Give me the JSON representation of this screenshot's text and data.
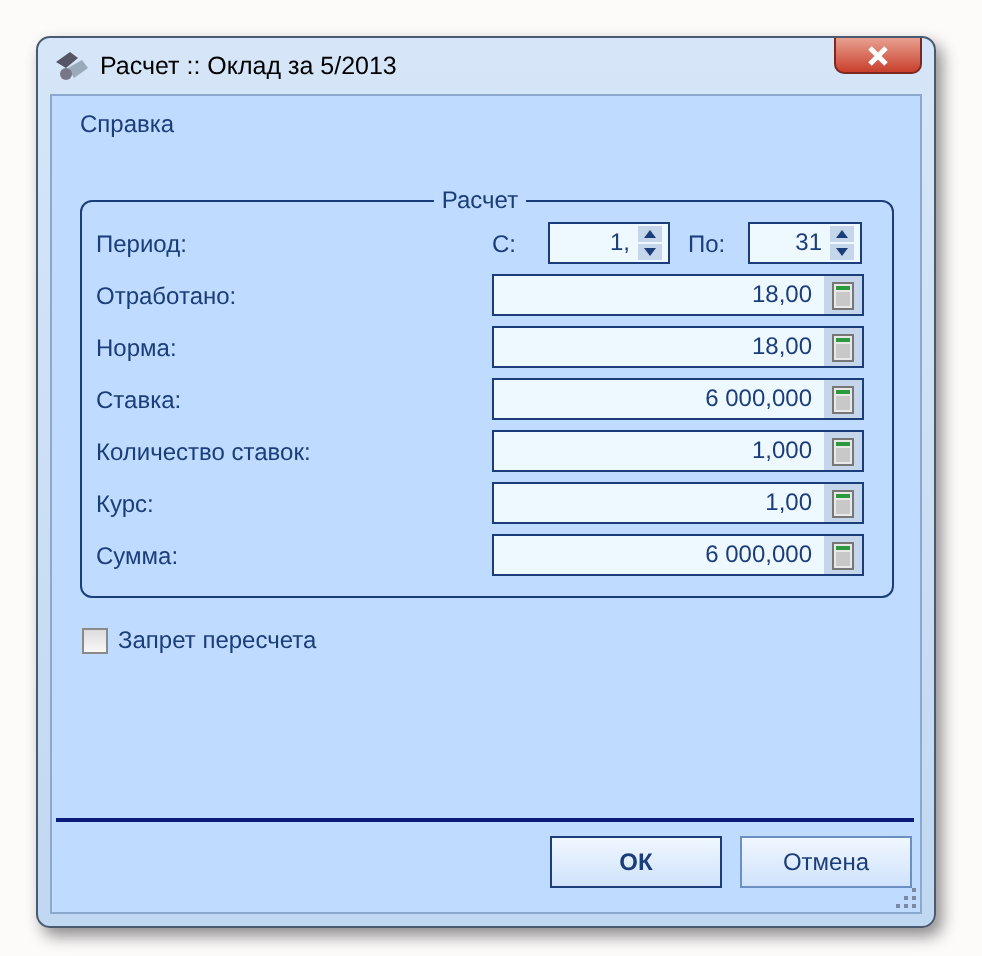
{
  "window": {
    "title": "Расчет :: Оклад за 5/2013"
  },
  "help_link": "Справка",
  "group": {
    "title": "Расчет",
    "period": {
      "label": "Период:",
      "from_label": "С:",
      "from_value": "1,",
      "to_label": "По:",
      "to_value": "31"
    },
    "fields": [
      {
        "label": "Отработано:",
        "value": "18,00"
      },
      {
        "label": "Норма:",
        "value": "18,00"
      },
      {
        "label": "Ставка:",
        "value": "6 000,000"
      },
      {
        "label": "Количество ставок:",
        "value": "1,000"
      },
      {
        "label": "Курс:",
        "value": "1,00"
      },
      {
        "label": "Сумма:",
        "value": "6 000,000"
      }
    ]
  },
  "recalc_lock": {
    "label": "Запрет пересчета",
    "checked": false
  },
  "buttons": [
    {
      "label": "ОК",
      "default": true
    },
    {
      "label": "Отмена",
      "default": false
    }
  ]
}
